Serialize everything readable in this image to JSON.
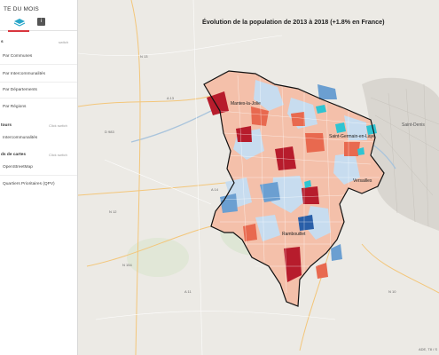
{
  "sidebar": {
    "title": "TE DU MOIS",
    "tabs": [
      {
        "name": "layers",
        "icon": "layers-icon"
      },
      {
        "name": "info",
        "icon": "info-icon"
      }
    ],
    "sections": [
      {
        "head": "s",
        "action": "switch",
        "items": [
          "Par Communes",
          "Par Intercommunalités",
          "Par Départements",
          "Par Régions"
        ]
      },
      {
        "head": "tours",
        "action": "Click  switch",
        "items": [
          "Intercommunalités"
        ]
      },
      {
        "head": "ds de cartes",
        "action": "Click  switch",
        "items": [
          "OpenStreetMap",
          "Quartiers Prioritaires (QPV)"
        ]
      }
    ]
  },
  "map": {
    "title": "Évolution de la population de 2013 à 2018 (+1.8% en France)",
    "places": [
      "Mantes-la-Jolie",
      "Saint-Germain-en-Laye",
      "Versailles",
      "Rambouillet",
      "Saint-Denis"
    ],
    "roads": [
      "N 13",
      "A 13",
      "A 14",
      "N 154",
      "A 11",
      "N 12",
      "N 10",
      "D 983"
    ],
    "attribution": "ADE, T8 / S",
    "colors": {
      "strong_growth": "#b71c2c",
      "growth": "#e8694f",
      "mild_growth": "#f7c5b0",
      "mild_decline": "#c7dcef",
      "decline": "#6b9fd1",
      "strong_decline": "#2a5fa8",
      "qpv": "#2fc4d2",
      "boundary": "#111111"
    }
  }
}
